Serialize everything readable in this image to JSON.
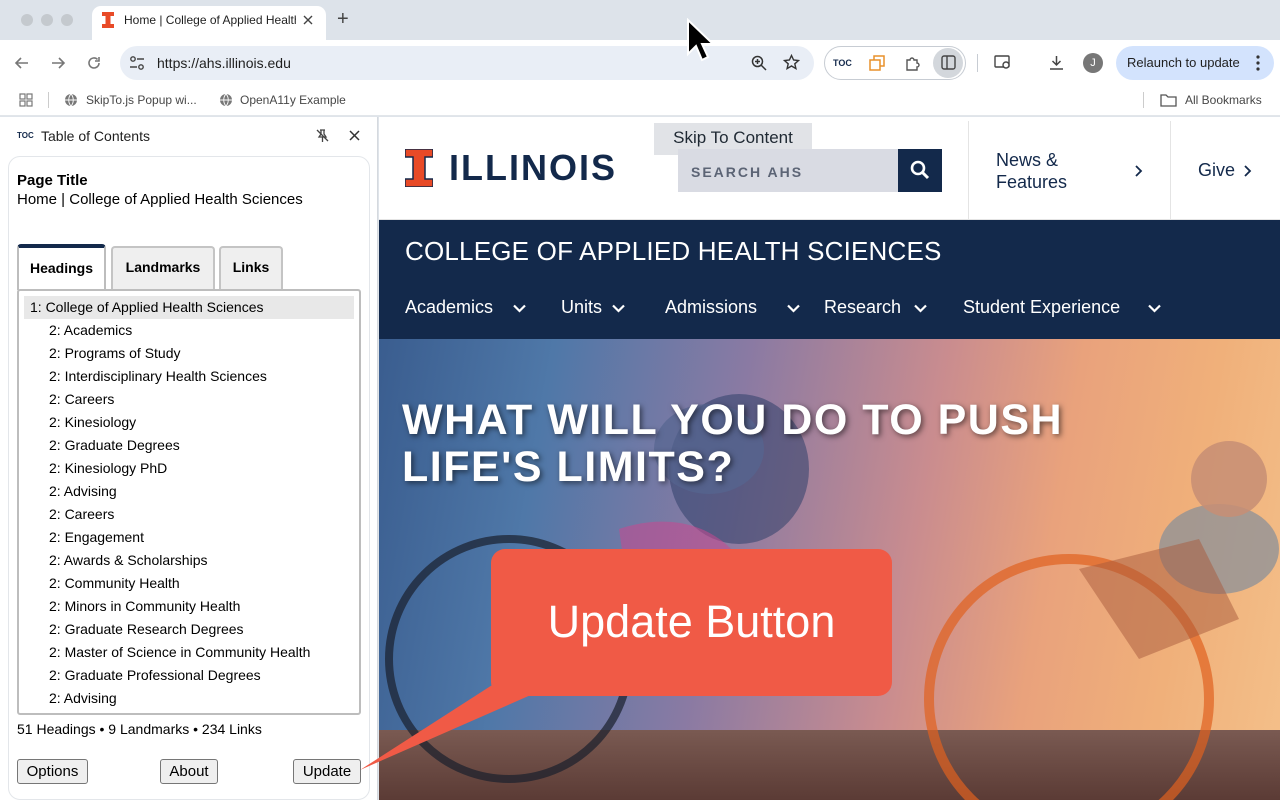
{
  "browser": {
    "tab_title": "Home | College of Applied Health Sciences",
    "new_tab_symbol": "+",
    "url": "https://ahs.illinois.edu",
    "relaunch_label": "Relaunch to update",
    "profile_initial": "J",
    "ext_toc_label": "TOC",
    "bookmarks": [
      "SkipTo.js Popup wi...",
      "OpenA11y Example"
    ],
    "all_bookmarks": "All Bookmarks"
  },
  "side_panel": {
    "logo_label": "TOC",
    "title": "Table of Contents",
    "page_title_label": "Page Title",
    "page_title_value": "Home | College of Applied Health Sciences",
    "tabs": [
      "Headings",
      "Landmarks",
      "Links"
    ],
    "active_tab": "Headings",
    "headings": [
      "1: College of Applied Health Sciences",
      "2: Academics",
      "2: Programs of Study",
      "2: Interdisciplinary Health Sciences",
      "2: Careers",
      "2: Kinesiology",
      "2: Graduate Degrees",
      "2: Kinesiology PhD",
      "2: Advising",
      "2: Careers",
      "2: Engagement",
      "2: Awards & Scholarships",
      "2: Community Health",
      "2: Minors in Community Health",
      "2: Graduate Research Degrees",
      "2: Master of Science in Community Health",
      "2: Graduate Professional Degrees",
      "2: Advising"
    ],
    "counts": "51 Headings • 9 Landmarks • 234 Links",
    "buttons": {
      "options": "Options",
      "about": "About",
      "update": "Update"
    }
  },
  "website": {
    "skip_link": "Skip To Content",
    "wordmark": "ILLINOIS",
    "search_placeholder": "SEARCH AHS",
    "news_label": "News & Features",
    "give_label": "Give",
    "college_name": "COLLEGE OF APPLIED HEALTH SCIENCES",
    "nav": [
      "Academics",
      "Units",
      "Admissions",
      "Research",
      "Student Experience"
    ],
    "hero_headline": "WHAT WILL YOU DO TO PUSH LIFE'S LIMITS?"
  },
  "annotation": {
    "text": "Update Button",
    "color": "#f05a46"
  },
  "colors": {
    "illinois_blue": "#13294b",
    "illinois_orange": "#e84a27"
  }
}
